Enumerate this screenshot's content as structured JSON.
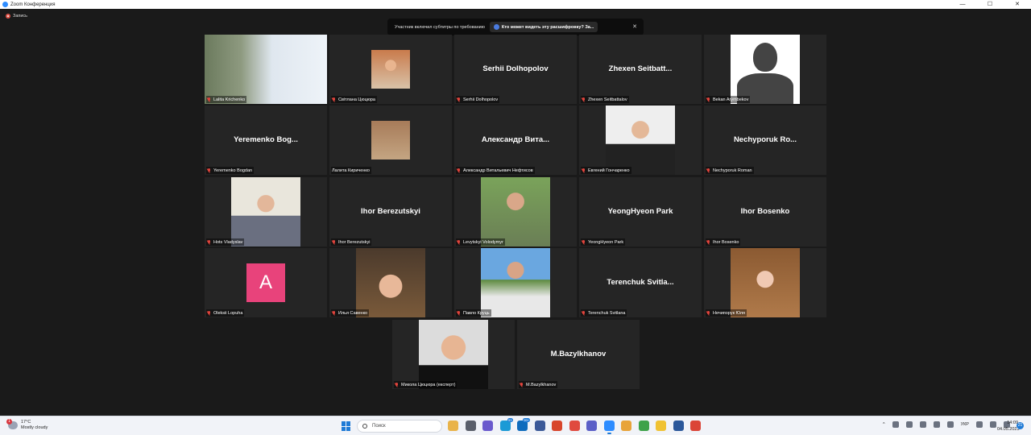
{
  "window": {
    "title": "Zoom Конференция",
    "controls": [
      "—",
      "☐",
      "✕"
    ]
  },
  "recording": {
    "label": "Запись"
  },
  "notice": {
    "text": "Участник включил субтитры по требованию",
    "button_label": "Кто может видеть эту расшифровку? За...",
    "close": "✕"
  },
  "tiles": [
    {
      "name": "Lalita Krichenko",
      "big": "",
      "photo": "ph-room",
      "active": true
    },
    {
      "name": "Світлана Цюцюра",
      "big": "",
      "photo": "ph-woman1"
    },
    {
      "name": "Serhii Dolhopolov",
      "big": "Serhii Dolhopolov"
    },
    {
      "name": "Zhexen Seitbattalov",
      "big": "Zhexen  Seitbatt..."
    },
    {
      "name": "Bekan Arymbekov",
      "big": "",
      "photo": "ph-silhouette"
    },
    {
      "name": "Yeremenko Bogdan",
      "big": "Yeremenko  Bog..."
    },
    {
      "name": "Лалита Кириченко",
      "big": "",
      "photo": "ph-beach",
      "muted": false
    },
    {
      "name": "Александр Витальевич Нефтисов",
      "big": "Александр  Вита..."
    },
    {
      "name": "Евгений Гончаренко",
      "big": "",
      "photo": "ph-young"
    },
    {
      "name": "Nechyporuk Roman",
      "big": "Nechyporuk  Ro..."
    },
    {
      "name": "Hots Vladyslav",
      "big": "",
      "photo": "ph-office"
    },
    {
      "name": "Ihor Berezutskyi",
      "big": "Ihor Berezutskyi"
    },
    {
      "name": "Levytskyi Volodymyr",
      "big": "",
      "photo": "ph-park"
    },
    {
      "name": "YeongHyeon Park",
      "big": "YeongHyeon Park"
    },
    {
      "name": "Ihor Bosenko",
      "big": "Ihor Bosenko"
    },
    {
      "name": "Oleksii Lopuha",
      "big": "",
      "avatar_letter": "A"
    },
    {
      "name": "Илья Савенко",
      "big": "",
      "photo": "ph-cap"
    },
    {
      "name": "Павло Круць",
      "big": "",
      "photo": "ph-tshirt"
    },
    {
      "name": "Terenchuk Svitlana",
      "big": "Terenchuk  Svitla..."
    },
    {
      "name": "Нечипорук Юля",
      "big": "",
      "photo": "ph-wood"
    },
    {
      "name": "Микола Цюцюра (експерт)",
      "big": "",
      "photo": "ph-man"
    },
    {
      "name": "M.Bazylkhanov",
      "big": "M.Bazylkhanov"
    }
  ],
  "taskbar": {
    "weather": {
      "temp": "17°C",
      "desc": "Mostly cloudy",
      "badge": "1"
    },
    "search_placeholder": "Поиск",
    "apps": [
      {
        "icon": "widgets-icon",
        "color": "#e9b34a"
      },
      {
        "icon": "files-icon",
        "color": "#5a5f6b"
      },
      {
        "icon": "chat-icon",
        "color": "#6a5acd"
      },
      {
        "icon": "edge-icon",
        "color": "#1b9ad6",
        "badge": "53"
      },
      {
        "icon": "mail-icon",
        "color": "#0f6cbd",
        "badge": "99+"
      },
      {
        "icon": "store-icon",
        "color": "#3b5998"
      },
      {
        "icon": "office-icon",
        "color": "#d8452b"
      },
      {
        "icon": "video-icon",
        "color": "#e04a3f"
      },
      {
        "icon": "teams-icon",
        "color": "#5b5fc7"
      },
      {
        "icon": "zoom-icon",
        "color": "#2d8cff",
        "active": true
      },
      {
        "icon": "chrome-icon",
        "color": "#e8a43a"
      },
      {
        "icon": "chrome2-icon",
        "color": "#3ea24a"
      },
      {
        "icon": "explorer-icon",
        "color": "#f0c233"
      },
      {
        "icon": "word-icon",
        "color": "#2b579a"
      },
      {
        "icon": "chrome3-icon",
        "color": "#db4437"
      }
    ],
    "lang": "УКР",
    "time": "14:09",
    "date": "04.05.2023",
    "notif_count": "21"
  }
}
